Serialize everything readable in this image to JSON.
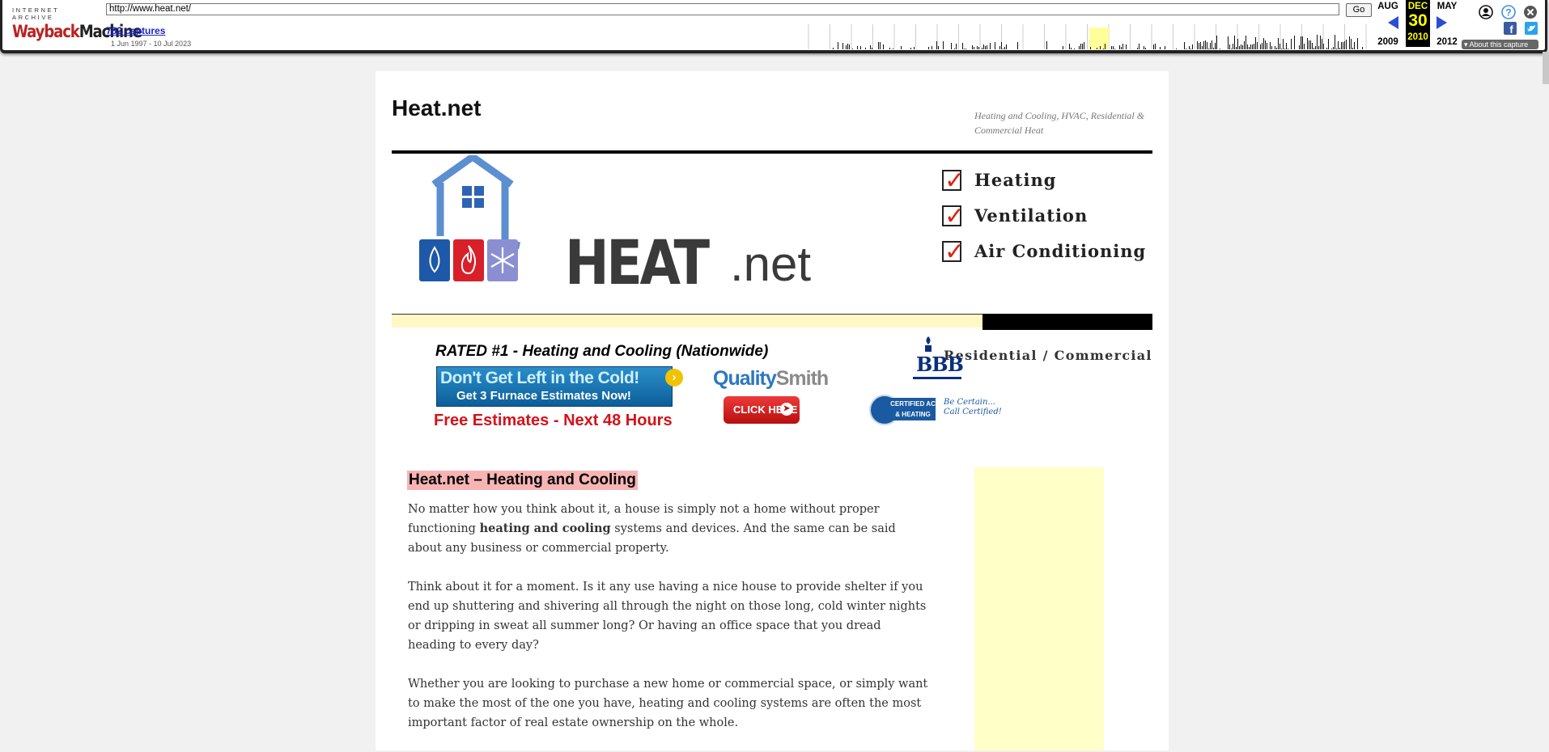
{
  "wayback": {
    "logo_top": "INTERNET ARCHIVE",
    "logo_main_1": "Wayback",
    "logo_main_2": "Machine",
    "url": "http://www.heat.net/",
    "go_label": "Go",
    "captures": "782 captures",
    "range": "1 Jun 1997 - 10 Jul 2023",
    "prev_month": "AUG",
    "cur_month": "DEC",
    "next_month": "MAY",
    "cur_day": "30",
    "prev_year": "2009",
    "cur_year": "2010",
    "next_year": "2012",
    "about_label": "About this capture",
    "icons": [
      "user-icon",
      "help-icon",
      "close-icon",
      "facebook-icon",
      "twitter-icon"
    ],
    "prev_arrow_color": "#2b4dd6",
    "next_arrow_color": "#2b4dd6"
  },
  "site": {
    "title": "Heat.net",
    "tagline": "Heating and Cooling, HVAC, Residential & Commercial Heat"
  },
  "banner": {
    "logo_heat": "HEAT",
    "logo_net": ".net",
    "checks": [
      "Heating",
      "Ventilation",
      "Air Conditioning"
    ],
    "segment": "Residential / Commercial",
    "colors": {
      "house": "#5b8fd0",
      "tile_blue": "#1e58a8",
      "tile_red": "#d8202a",
      "tile_lilac": "#8b8fd2",
      "check": "#d21f1f",
      "yellow_bar": "#fff8c4"
    }
  },
  "ad": {
    "rated": "RATED #1 - Heating and Cooling (Nationwide)",
    "banner_line1": "Don't Get Left in the Cold!",
    "banner_line2": "Get 3 Furnace Estimates Now!",
    "free": "Free Estimates - Next 48 Hours",
    "qs_1": "Quality",
    "qs_2": "Smith",
    "click_here": "CLICK HERE",
    "bbb": "BBB",
    "cert_label": "CERTIFIED AC & HEATING",
    "cert_note": "Be Certain... Call Certified!"
  },
  "content": {
    "heading": "Heat.net – Heating and Cooling",
    "p1_pre": "No matter how you think about it, a house is simply not a home without proper functioning ",
    "p1_bold": "heating and cooling",
    "p1_post": " systems and devices. And the same can be said about any business or commercial property.",
    "p2": "Think about it for a moment. Is it any use having a nice house to provide shelter if you end up shuttering and shivering all through the night on those long, cold winter nights or dripping in sweat all summer long? Or having an office space that you dread heading to every day?",
    "p3": "Whether you are looking to purchase a new home or commercial space, or simply want to make the most of the one you have, heating and cooling systems are often the most important factor of real estate ownership on the whole."
  }
}
